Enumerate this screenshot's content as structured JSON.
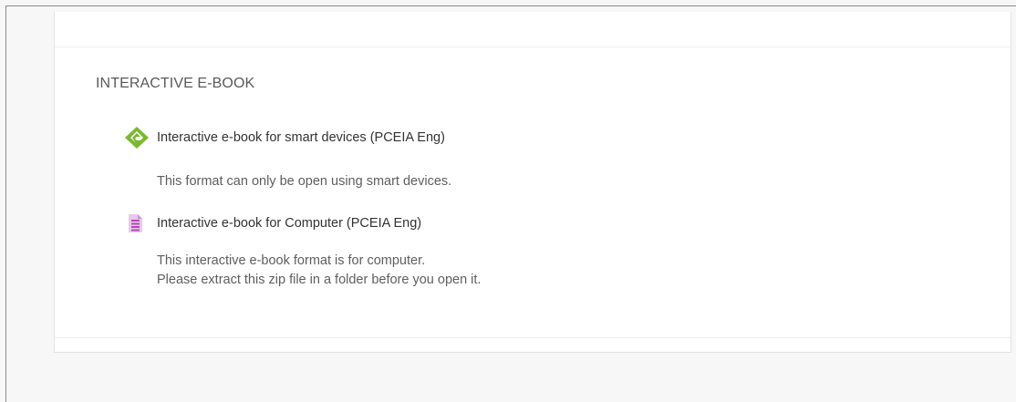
{
  "section": {
    "title": "INTERACTIVE E-BOOK"
  },
  "items": [
    {
      "icon": "epub-icon",
      "icon_color": "#7cb82f",
      "label": "Interactive e-book for smart devices (PCEIA Eng)",
      "description": [
        "This format can only be open using smart devices."
      ]
    },
    {
      "icon": "zip-archive-icon",
      "icon_color": "#b24bb7",
      "label": "Interactive e-book for Computer (PCEIA Eng)",
      "description": [
        "This interactive e-book format is for computer.",
        "Please extract this zip file in a folder before you open it."
      ]
    }
  ]
}
